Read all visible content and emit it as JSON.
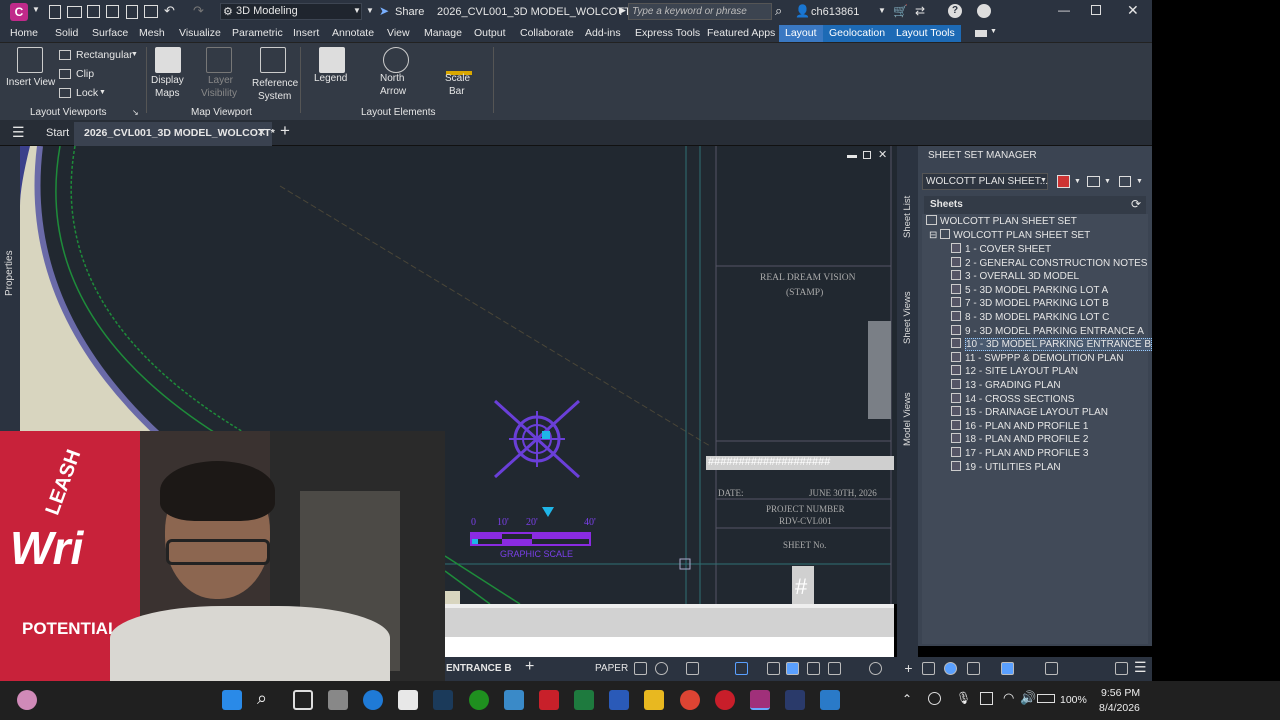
{
  "app": {
    "logo_letter": "C",
    "workspace": "3D Modeling",
    "share_label": "Share",
    "file_title": "2026_CVL001_3D MODEL_WOLCOTT.d...",
    "search_placeholder": "Type a keyword or phrase",
    "user": "ch613861"
  },
  "menu": [
    "Home",
    "Solid",
    "Surface",
    "Mesh",
    "Visualize",
    "Parametric",
    "Insert",
    "Annotate",
    "View",
    "Manage",
    "Output",
    "Collaborate",
    "Add-ins",
    "Express Tools",
    "Featured Apps",
    "Layout",
    "Geolocation",
    "Layout Tools"
  ],
  "ribbon": {
    "insert_view": "Insert View",
    "rectangular": "Rectangular",
    "clip": "Clip",
    "lock": "Lock",
    "display_maps": [
      "Display",
      "Maps"
    ],
    "layer_visibility": [
      "Layer",
      "Visibility"
    ],
    "reference_system": [
      "Reference",
      "System"
    ],
    "legend": "Legend",
    "north_arrow": [
      "North",
      "Arrow"
    ],
    "scale_bar": [
      "Scale",
      "Bar"
    ],
    "panels": {
      "layout_viewports": "Layout Viewports",
      "map_viewport": "Map Viewport",
      "layout_elements": "Layout Elements"
    }
  },
  "doc_tabs": {
    "start": "Start",
    "active": "2026_CVL001_3D MODEL_WOLCOTT*"
  },
  "side_label": "Properties",
  "drawing": {
    "stamp_line1": "REAL DREAM VISION",
    "stamp_line2": "(STAMP)",
    "hash_strip": "####################",
    "date_label": "DATE:",
    "date_value": "JUNE 30TH, 2026",
    "project_number_label": "PROJECT NUMBER",
    "project_number_value": "RDV-CVL001",
    "sheet_no_label": "SHEET No.",
    "sheet_no_value": "#",
    "scale_ticks": [
      "0",
      "10'",
      "20'",
      "40'"
    ],
    "scale_caption": "GRAPHIC SCALE"
  },
  "ssm": {
    "title": "SHEET SET MANAGER",
    "dropdown": "WOLCOTT PLAN SHEET...",
    "sheets_header": "Sheets",
    "side_tabs": [
      "Sheet List",
      "Sheet Views",
      "Model Views"
    ],
    "root": "WOLCOTT PLAN SHEET SET",
    "subset": "WOLCOTT PLAN SHEET SET",
    "items": [
      "1 - COVER SHEET",
      "2 - GENERAL CONSTRUCTION NOTES",
      "3 - OVERALL 3D MODEL",
      "5 - 3D MODEL PARKING LOT A",
      "7 - 3D MODEL PARKING LOT B",
      "8 - 3D MODEL PARKING LOT C",
      "9 - 3D MODEL PARKING ENTRANCE A",
      "10 - 3D MODEL PARKING ENTRANCE B",
      "11 - SWPPP & DEMOLITION PLAN",
      "12 - SITE LAYOUT PLAN",
      "13 - GRADING PLAN",
      "14 - CROSS SECTIONS",
      "15 - DRAINAGE LAYOUT PLAN",
      "16 - PLAN AND PROFILE 1",
      "18 - PLAN AND PROFILE 2",
      "17 - PLAN AND PROFILE 3",
      "19 - UTILITIES PLAN"
    ],
    "selected_index": 7
  },
  "status": {
    "layout_tab": "ENTRANCE B",
    "paper": "PAPER"
  },
  "webcam_text": {
    "top": "LEASH",
    "mid": "Wri",
    "bottom": "POTENTIAL"
  },
  "taskbar": {
    "battery": "100%",
    "time": "9:56 PM",
    "date": "8/4/2026"
  },
  "colors": {
    "accent": "#3a78c2",
    "north_arrow": "#6a3fd8",
    "scale_bar": "#8a2be2",
    "drawing_bg": "#212830"
  }
}
